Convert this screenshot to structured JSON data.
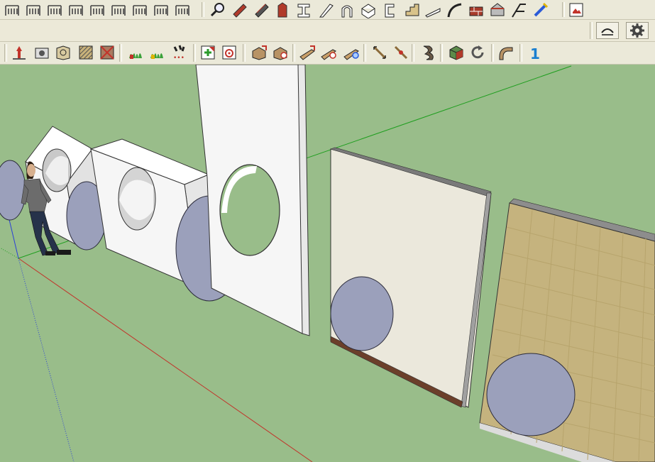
{
  "toolbars": {
    "row1": {
      "left_group": [
        {
          "icon": "rail-tool-1-icon"
        },
        {
          "icon": "rail-tool-2-icon"
        },
        {
          "icon": "rail-tool-3-icon"
        },
        {
          "icon": "rail-tool-4-icon"
        },
        {
          "icon": "rail-tool-5-icon"
        },
        {
          "icon": "rail-tool-6-icon"
        },
        {
          "icon": "rail-tool-7-icon"
        },
        {
          "icon": "rail-tool-8-icon"
        },
        {
          "icon": "rail-tool-9-icon"
        }
      ],
      "right_group": [
        {
          "icon": "magnify-tool-icon"
        },
        {
          "icon": "beam-red-icon"
        },
        {
          "icon": "beam-dark-icon"
        },
        {
          "icon": "column-red-icon"
        },
        {
          "icon": "i-beam-icon"
        },
        {
          "icon": "angle-profile-icon"
        },
        {
          "icon": "arch-profile-icon"
        },
        {
          "icon": "box-profile-icon"
        },
        {
          "icon": "channel-profile-icon"
        },
        {
          "icon": "stair-block-icon"
        },
        {
          "icon": "slope-profile-icon"
        },
        {
          "icon": "curved-rail-icon"
        },
        {
          "icon": "brick-corner-icon"
        },
        {
          "icon": "roof-block-icon"
        },
        {
          "icon": "frame-corner-icon"
        },
        {
          "icon": "pipe-wand-icon"
        },
        {
          "icon": "image-export-icon"
        }
      ]
    },
    "row2": {
      "right_buttons": [
        {
          "icon": "arch-toggle-icon"
        },
        {
          "icon": "gear-icon"
        }
      ]
    },
    "row3": {
      "items": [
        {
          "icon": "red-up-arrow-icon"
        },
        {
          "icon": "camera-box-icon"
        },
        {
          "icon": "circle-face-icon"
        },
        {
          "icon": "hatch-face-icon"
        },
        {
          "icon": "diagonal-face-icon"
        },
        {
          "icon": "grass-red-icon"
        },
        {
          "icon": "grass-yellow-icon"
        },
        {
          "icon": "scatter-red-icon"
        },
        {
          "icon": "paint-red-plus-icon"
        },
        {
          "icon": "paint-target-icon"
        },
        {
          "icon": "box-arrow-1-icon"
        },
        {
          "icon": "box-target-icon"
        },
        {
          "icon": "plank-arrow-icon"
        },
        {
          "icon": "plank-target-icon"
        },
        {
          "icon": "plank-blue-icon"
        },
        {
          "icon": "dim-line-1-icon"
        },
        {
          "icon": "dim-line-2-icon"
        },
        {
          "icon": "twist-icon"
        },
        {
          "icon": "material-cube-icon"
        },
        {
          "icon": "refresh-icon"
        },
        {
          "icon": "curve-solid-icon"
        },
        {
          "icon": "number-one-icon"
        }
      ]
    }
  },
  "colors": {
    "ground": "#99bd8a",
    "toolbar_bg": "#ebe9d9",
    "sky": "#ffffff",
    "disk": "#9ba0bb",
    "panel_white": "#f7f7f7",
    "panel_cream": "#ebe8dc",
    "tile": "#c5b37e",
    "axis_red": "#c2332a",
    "axis_green": "#1f9e1f",
    "axis_blue": "#2b3fd8"
  },
  "scene": {
    "objects": [
      "figure-person",
      "white-block-hole-left",
      "white-block-hole-middle",
      "tall-white-panel-hole",
      "cream-panel",
      "tiled-panel",
      "blue-disk-1",
      "blue-disk-2",
      "blue-disk-3",
      "blue-disk-4",
      "blue-disk-5",
      "blue-disk-6"
    ]
  }
}
